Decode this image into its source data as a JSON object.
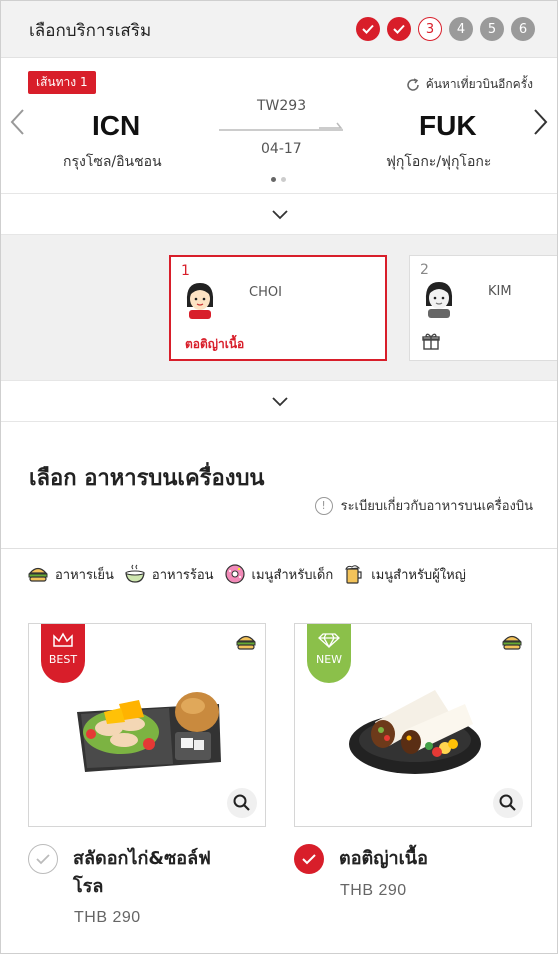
{
  "header": {
    "title": "เลือกบริการเสริม",
    "steps": [
      {
        "label": "",
        "state": "done"
      },
      {
        "label": "",
        "state": "done"
      },
      {
        "label": "3",
        "state": "current"
      },
      {
        "label": "4",
        "state": "todo"
      },
      {
        "label": "5",
        "state": "todo"
      },
      {
        "label": "6",
        "state": "todo"
      }
    ]
  },
  "route": {
    "segment_label": "เส้นทาง 1",
    "research_label": "ค้นหาเที่ยวบินอีกครั้ง",
    "origin_code": "ICN",
    "origin_city": "กรุงโซล/อินชอน",
    "dest_code": "FUK",
    "dest_city": "ฟุกุโอกะ/ฟุกุโอกะ",
    "flight_no": "TW293",
    "date": "04-17"
  },
  "passengers": [
    {
      "num": "1",
      "name": "CHOI",
      "meal": "ตอติญ่าเนื้อ",
      "selected": true
    },
    {
      "num": "2",
      "name": "KIM",
      "meal": "",
      "selected": false
    }
  ],
  "meal_section": {
    "title": "เลือก อาหารบนเครื่องบน",
    "rules_label": "ระเบียบเกี่ยวกับอาหารบนเครื่องบิน"
  },
  "legend": {
    "cold": "อาหารเย็น",
    "hot": "อาหารร้อน",
    "kids": "เมนูสำหรับเด็ก",
    "adult": "เมนูสำหรับผู้ใหญ่"
  },
  "meals": [
    {
      "badge": "BEST",
      "name_line1": "สลัดอกไก่&ซอล์ฟ",
      "name_line2": "โรล",
      "price": "THB 290",
      "selected": false
    },
    {
      "badge": "NEW",
      "name_line1": "ตอติญ่าเนื้อ",
      "name_line2": "",
      "price": "THB 290",
      "selected": true
    }
  ],
  "colors": {
    "accent": "#d81e2a",
    "new_badge": "#8bc04a"
  }
}
